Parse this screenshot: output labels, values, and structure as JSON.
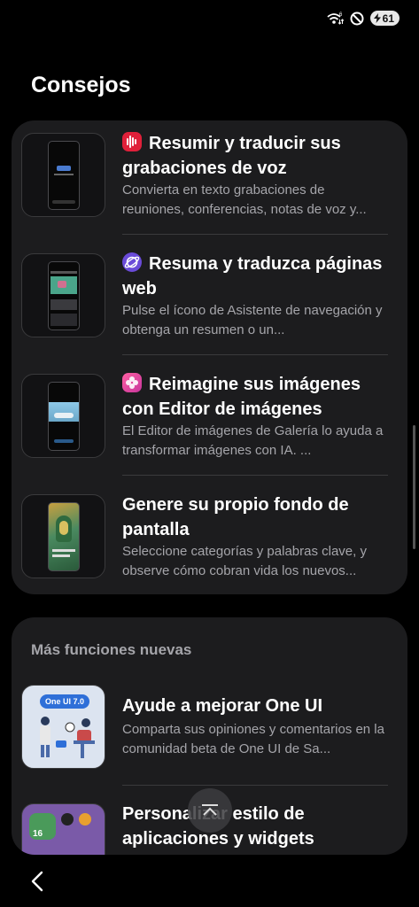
{
  "status_bar": {
    "battery": "61"
  },
  "page": {
    "title": "Consejos"
  },
  "tips": [
    {
      "icon": "voice-recorder-icon",
      "color": "#e0203a",
      "title": "Resumir y traducir sus grabaciones de voz",
      "description": "Convierta en texto grabaciones de reuniones, conferencias, notas de voz y..."
    },
    {
      "icon": "internet-browser-icon",
      "color": "#6a4bd8",
      "title": "Resuma y traduzca páginas web",
      "description": "Pulse el ícono de Asistente de navegación y obtenga un resumen o un..."
    },
    {
      "icon": "gallery-icon",
      "color": "#e83e8c",
      "title": "Reimagine sus imágenes con Editor de imágenes",
      "description": "El Editor de imágenes de Galería lo ayuda a transformar imágenes con IA. ..."
    },
    {
      "title": "Genere su propio fondo de pantalla",
      "description": "Seleccione categorías y palabras clave, y observe cómo cobran vida los nuevos..."
    }
  ],
  "more_features": {
    "header": "Más funciones nuevas",
    "items": [
      {
        "badge": "One UI 7.0",
        "title": "Ayude a mejorar One UI",
        "description": "Comparta sus opiniones y comentarios en la comunidad beta de One UI de Sa..."
      },
      {
        "widget_number": "16",
        "title": "Personalizar estilo de aplicaciones y widgets",
        "description": ""
      }
    ]
  }
}
